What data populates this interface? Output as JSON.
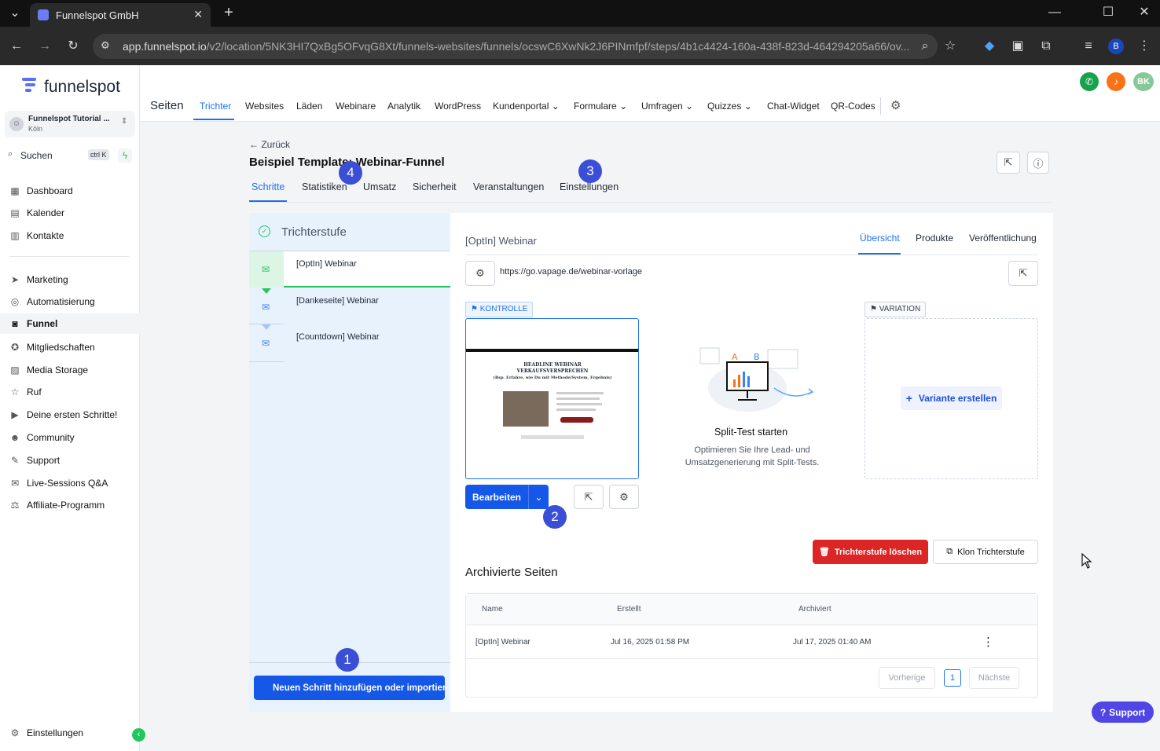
{
  "browser": {
    "tab_title": "Funnelspot GmbH",
    "url_host": "app.funnelspot.io",
    "url_path": "/v2/location/5NK3HI7QxBg5OFvqG8Xt/funnels-websites/funnels/ocswC6XwNk2J6PINmfpf/steps/4b1c4424-160a-438f-823d-464294205a66/ov...",
    "profile_initial": "B"
  },
  "sidebar": {
    "logo": "funnelspot",
    "account_name": "Funnelspot Tutorial ...",
    "account_city": "Köln",
    "search_label": "Suchen",
    "search_shortcut": "ctrl K",
    "items": [
      {
        "label": "Dashboard",
        "icon": "grid-icon"
      },
      {
        "label": "Kalender",
        "icon": "calendar-icon"
      },
      {
        "label": "Kontakte",
        "icon": "contacts-icon"
      },
      {
        "label": "Marketing",
        "icon": "send-icon"
      },
      {
        "label": "Automatisierung",
        "icon": "automation-icon"
      },
      {
        "label": "Funnel",
        "icon": "funnel-icon"
      },
      {
        "label": "Mitgliedschaften",
        "icon": "membership-icon"
      },
      {
        "label": "Media Storage",
        "icon": "image-icon"
      },
      {
        "label": "Ruf",
        "icon": "star-icon"
      },
      {
        "label": "Deine ersten Schritte!",
        "icon": "play-icon"
      },
      {
        "label": "Community",
        "icon": "people-icon"
      },
      {
        "label": "Support",
        "icon": "wrench-icon"
      },
      {
        "label": "Live-Sessions Q&A",
        "icon": "chat-icon"
      },
      {
        "label": "Affiliate-Programm",
        "icon": "affiliate-icon"
      }
    ],
    "settings_label": "Einstellungen"
  },
  "topnav": {
    "section": "Seiten",
    "items": [
      "Trichter",
      "Websites",
      "Läden",
      "Webinare",
      "Analytik",
      "WordPress",
      "Kundenportal",
      "Formulare",
      "Umfragen",
      "Quizzes",
      "Chat-Widget",
      "QR-Codes"
    ],
    "user_initials": "BK"
  },
  "page": {
    "back": "Zurück",
    "title": "Beispiel Template: Webinar-Funnel",
    "tabs": [
      "Schritte",
      "Statistiken",
      "Umsatz",
      "Sicherheit",
      "Veranstaltungen",
      "Einstellungen"
    ]
  },
  "steps": {
    "header": "Trichterstufe",
    "items": [
      "[OptIn] Webinar",
      "[Dankeseite] Webinar",
      "[Countdown] Webinar"
    ],
    "add_button": "Neuen Schritt hinzufügen oder importieren"
  },
  "detail": {
    "step_name": "[OptIn] Webinar",
    "tabs": [
      "Übersicht",
      "Produkte",
      "Veröffentlichung"
    ],
    "url": "https://go.vapage.de/webinar-vorlage",
    "control_label": "KONTROLLE",
    "variation_label": "VARIATION",
    "preview_headline": "HEADLINE WEBINAR VERKAUFSVERSPRECHEN",
    "preview_sub": "(Bsp. Erfahre, wie Du mit Methode/System, Ergebnis)",
    "edit_button": "Bearbeiten",
    "split_title": "Split-Test starten",
    "split_desc": "Optimieren Sie Ihre Lead- und Umsatzgenerierung mit Split-Tests.",
    "create_variant": "Variante erstellen",
    "delete_button": "Trichterstufe löschen",
    "clone_button": "Klon Trichterstufe"
  },
  "archived": {
    "title": "Archivierte Seiten",
    "columns": [
      "Name",
      "Erstellt",
      "Archiviert"
    ],
    "rows": [
      {
        "name": "[OptIn] Webinar",
        "created": "Jul 16, 2025 01:58 PM",
        "archived": "Jul 17, 2025 01:40 AM"
      }
    ],
    "prev": "Vorherige",
    "page": "1",
    "next": "Nächste"
  },
  "annotations": [
    "1",
    "2",
    "3",
    "4"
  ],
  "support_button": "Support",
  "colors": {
    "accent": "#1d72e8",
    "danger": "#dc2626",
    "primary_btn": "#1557e6",
    "badge": "#3b4fd6"
  }
}
